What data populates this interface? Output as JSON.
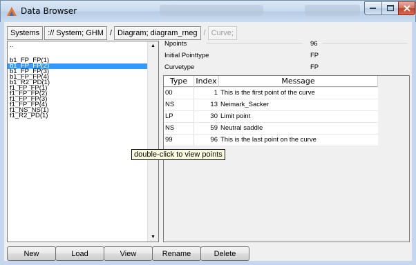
{
  "window": {
    "title": "Data Browser"
  },
  "breadcrumb": {
    "items": [
      {
        "label": "Systems"
      },
      {
        "label": ":// System; GHM"
      },
      {
        "label": "Diagram; diagram_rneg"
      },
      {
        "label": "Curve;"
      }
    ],
    "separators": [
      "/",
      "/"
    ]
  },
  "left_list": {
    "items": [
      {
        "label": ".."
      },
      {
        "label": "b1_FP_FP(1)"
      },
      {
        "label": "b1_FP_FP(2)",
        "selected": true
      },
      {
        "label": "b1_FP_FP(3)"
      },
      {
        "label": "b1_FP_FP(4)"
      },
      {
        "label": "b1_R2_PD(1)"
      },
      {
        "label": "f1_FP_FP(1)"
      },
      {
        "label": "f1_FP_FP(2)"
      },
      {
        "label": "f1_FP_FP(3)"
      },
      {
        "label": "f1_FP_FP(4)"
      },
      {
        "label": "f1_NS_NS(1)"
      },
      {
        "label": "f1_R2_PD(1)"
      }
    ]
  },
  "info": {
    "rows": [
      {
        "key": "Npoints",
        "value": "96"
      },
      {
        "key": "Initial Pointtype",
        "value": "FP"
      },
      {
        "key": "Curvetype",
        "value": "FP"
      }
    ]
  },
  "table": {
    "headers": [
      "Type",
      "Index",
      "Message"
    ],
    "rows": [
      [
        "00",
        "1",
        "This is the first point of the curve"
      ],
      [
        "NS",
        "13",
        "Neimark_Sacker"
      ],
      [
        "LP",
        "30",
        "Limit point"
      ],
      [
        "NS",
        "59",
        "Neutral saddle"
      ],
      [
        "99",
        "96",
        "This is the last point on the curve"
      ]
    ]
  },
  "tooltip": {
    "text": "double-click to view points"
  },
  "buttons": {
    "new": "New",
    "load": "Load",
    "view": "View",
    "rename": "Rename",
    "delete": "Delete"
  }
}
